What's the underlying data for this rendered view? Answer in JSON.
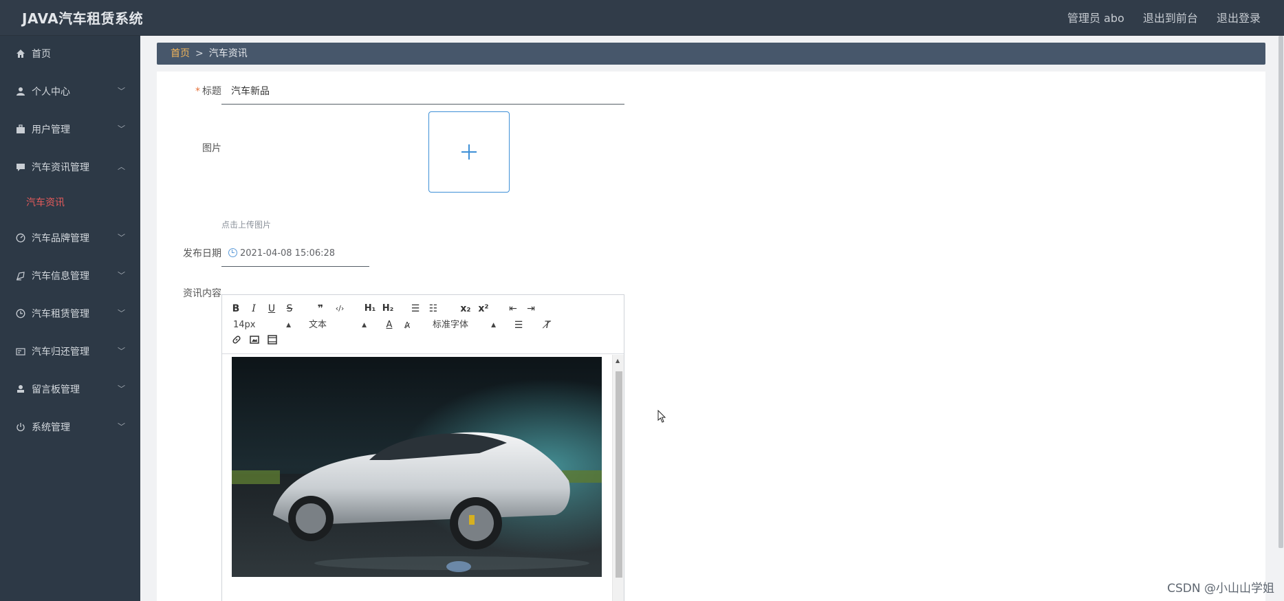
{
  "app": {
    "title": "JAVA汽车租赁系统"
  },
  "header": {
    "user_label": "管理员 abo",
    "to_front": "退出到前台",
    "logout": "退出登录"
  },
  "sidebar": {
    "items": [
      {
        "label": "首页",
        "icon": "home-icon"
      },
      {
        "label": "个人中心",
        "icon": "user-icon"
      },
      {
        "label": "用户管理",
        "icon": "briefcase-icon"
      },
      {
        "label": "汽车资讯管理",
        "icon": "chat-icon"
      },
      {
        "label": "汽车品牌管理",
        "icon": "gauge-icon"
      },
      {
        "label": "汽车信息管理",
        "icon": "car-icon"
      },
      {
        "label": "汽车租赁管理",
        "icon": "clock-icon"
      },
      {
        "label": "汽车归还管理",
        "icon": "card-icon"
      },
      {
        "label": "留言板管理",
        "icon": "person-icon"
      },
      {
        "label": "系统管理",
        "icon": "power-icon"
      }
    ],
    "active_sub": "汽车资讯"
  },
  "breadcrumb": {
    "home": "首页",
    "separator": ">",
    "current": "汽车资讯"
  },
  "form": {
    "title_label": "标题",
    "title_value": "汽车新品",
    "required_mark": "*",
    "image_label": "图片",
    "upload_tip": "点击上传图片",
    "date_label": "发布日期",
    "date_value": "2021-04-08 15:06:28",
    "content_label": "资讯内容"
  },
  "editor": {
    "toolbar_row1": [
      "B",
      "I",
      "U",
      "S",
      "❞",
      "‹/›",
      "H₁",
      "H₂",
      "☰",
      "☷",
      "x₂",
      "x²",
      "⇤",
      "⇥"
    ],
    "font_size": "14px",
    "text_style": "文本",
    "font_family": "标准字体"
  },
  "watermark": "CSDN @小山山学姐"
}
